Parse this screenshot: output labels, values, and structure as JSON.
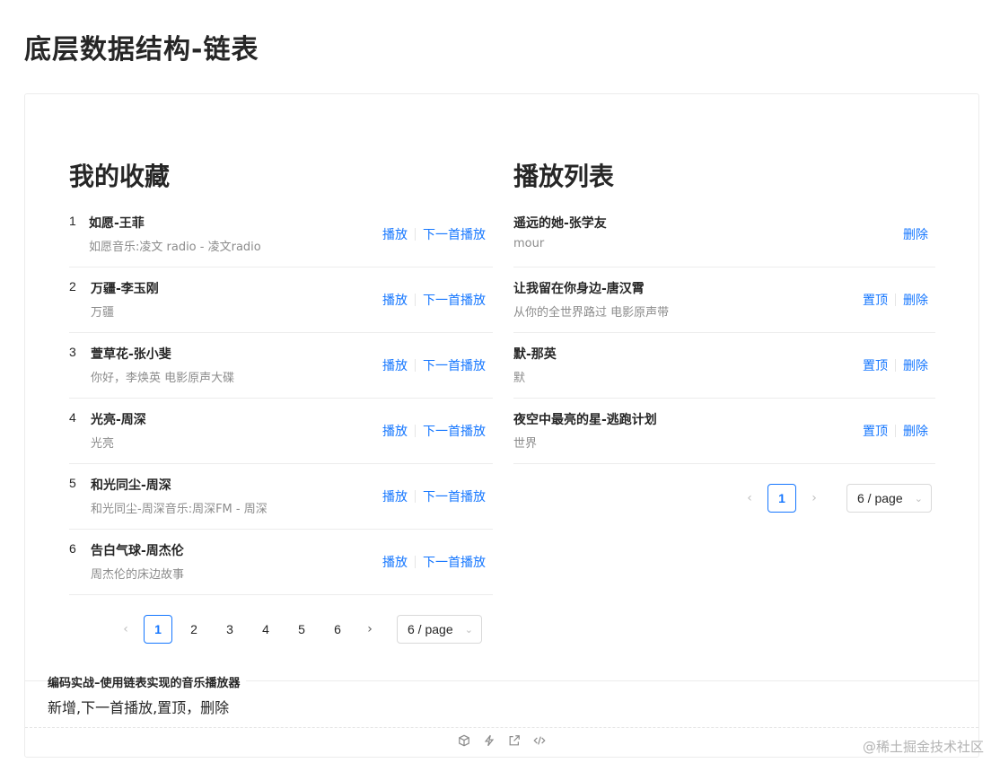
{
  "page": {
    "title": "底层数据结构-链表"
  },
  "favorites": {
    "title": "我的收藏",
    "items": [
      {
        "index": "1",
        "title": "如愿-王菲",
        "desc": "如愿音乐:凌文 radio - 凌文radio",
        "play": "播放",
        "next": "下一首播放"
      },
      {
        "index": "2",
        "title": "万疆-李玉刚",
        "desc": "万疆",
        "play": "播放",
        "next": "下一首播放"
      },
      {
        "index": "3",
        "title": "萱草花-张小斐",
        "desc": "你好，李焕英 电影原声大碟",
        "play": "播放",
        "next": "下一首播放"
      },
      {
        "index": "4",
        "title": "光亮-周深",
        "desc": "光亮",
        "play": "播放",
        "next": "下一首播放"
      },
      {
        "index": "5",
        "title": "和光同尘-周深",
        "desc": "和光同尘-周深音乐:周深FM - 周深",
        "play": "播放",
        "next": "下一首播放"
      },
      {
        "index": "6",
        "title": "告白气球-周杰伦",
        "desc": "周杰伦的床边故事",
        "play": "播放",
        "next": "下一首播放"
      }
    ],
    "pagination": {
      "pages": [
        "1",
        "2",
        "3",
        "4",
        "5",
        "6"
      ],
      "current": "1",
      "page_size": "6 / page",
      "prev": "‹",
      "next": "›"
    }
  },
  "playlist": {
    "title": "播放列表",
    "items": [
      {
        "title": "遥远的她-张学友",
        "desc": "mour",
        "top": "",
        "delete": "删除"
      },
      {
        "title": "让我留在你身边-唐汉霄",
        "desc": "从你的全世界路过 电影原声带",
        "top": "置顶",
        "delete": "删除"
      },
      {
        "title": "默-那英",
        "desc": "默",
        "top": "置顶",
        "delete": "删除"
      },
      {
        "title": "夜空中最亮的星-逃跑计划",
        "desc": "世界",
        "top": "置顶",
        "delete": "删除"
      }
    ],
    "pagination": {
      "pages": [
        "1"
      ],
      "current": "1",
      "page_size": "6 / page",
      "prev": "‹",
      "next": "›"
    }
  },
  "footer": {
    "desc_title": "编码实战–使用链表实现的音乐播放器",
    "desc_text": "新增,下一首播放,置顶，删除",
    "tools": [
      "sandbox-icon",
      "lightning-icon",
      "external-link-icon",
      "code-icon"
    ]
  },
  "watermark": "@稀土掘金技术社区",
  "colors": {
    "link": "#1677ff",
    "muted": "#8c8c8c",
    "text": "#262626"
  }
}
